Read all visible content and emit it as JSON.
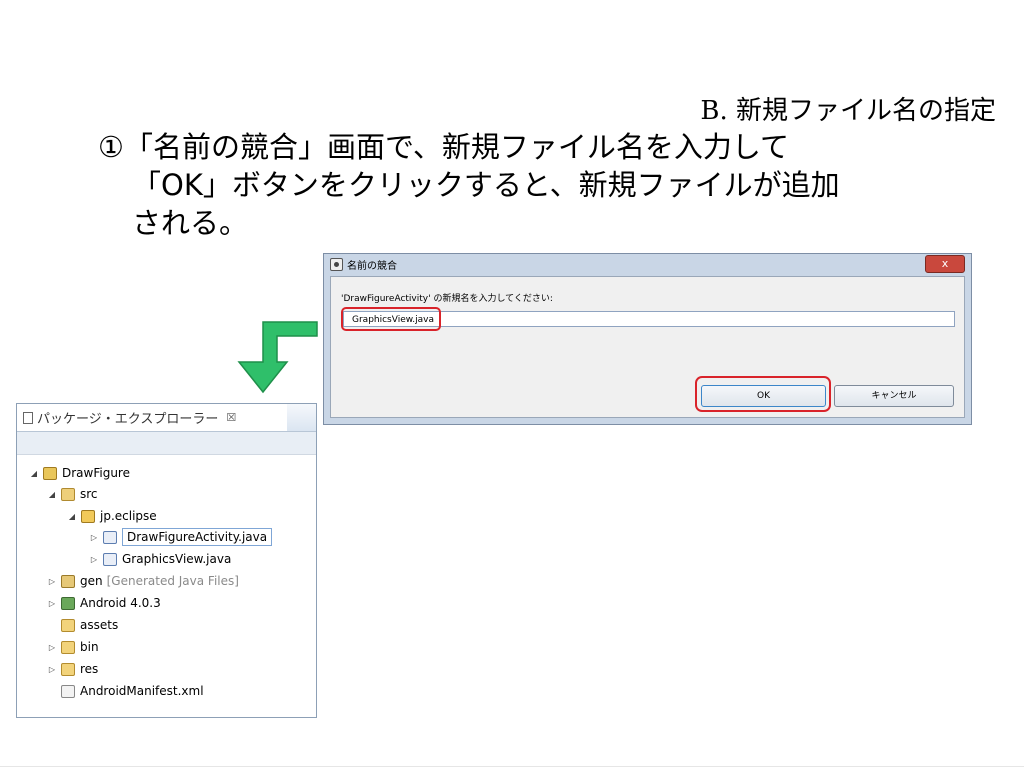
{
  "subtitle": "B. 新規ファイル名の指定",
  "instruction": {
    "line1": "①「名前の競合」画面で、新規ファイル名を入力して",
    "line2": "「OK」ボタンをクリックすると、新規ファイルが追加",
    "line3": "される。"
  },
  "dialog": {
    "title": "名前の競合",
    "close": "x",
    "prompt": "'DrawFigureActivity' の新規名を入力してください:",
    "input_value": "GraphicsView.java",
    "ok_label": "OK",
    "cancel_label": "キャンセル"
  },
  "explorer": {
    "tab_title": "パッケージ・エクスプローラー",
    "tab_close": "☒",
    "items": [
      {
        "label": "DrawFigure"
      },
      {
        "label": "src"
      },
      {
        "label": "jp.eclipse"
      },
      {
        "label": "DrawFigureActivity.java"
      },
      {
        "label": "GraphicsView.java"
      },
      {
        "label": "gen",
        "suffix": "[Generated Java Files]"
      },
      {
        "label": "Android 4.0.3"
      },
      {
        "label": "assets"
      },
      {
        "label": "bin"
      },
      {
        "label": "res"
      },
      {
        "label": "AndroidManifest.xml"
      }
    ]
  }
}
